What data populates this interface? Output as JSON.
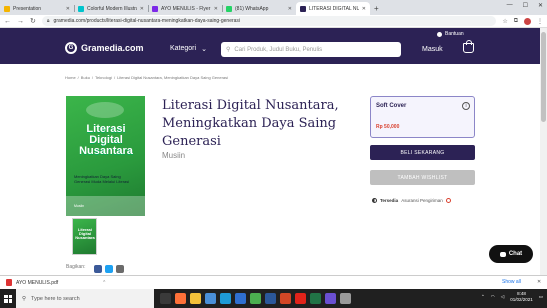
{
  "browser": {
    "tabs": [
      {
        "title": "Presentation",
        "color": "#f4b400"
      },
      {
        "title": "Colorful Modern Illustrated Lin...",
        "color": "#00c4cc"
      },
      {
        "title": "AYO MENULIS - Flyer (A4)",
        "color": "#7d2ae8"
      },
      {
        "title": "(81) WhatsApp",
        "color": "#25d366"
      },
      {
        "title": "LITERASI DIGITAL NUSANTARA...",
        "color": "#2c2255"
      }
    ],
    "new_tab": "+",
    "url": "gramedia.com/products/literasi-digital-nusantara-meningkatkan-daya-saing-generasi"
  },
  "header": {
    "logo": "Gramedia.com",
    "logo_letter": "G",
    "kategori": "Kategori",
    "search_placeholder": "Cari Produk, Judul Buku, Penulis",
    "bantuan": "Bantuan",
    "masuk": "Masuk"
  },
  "breadcrumb": [
    "Home",
    "/",
    "Buku",
    "/",
    "Teknologi",
    "/",
    "Literasi Digital Nusantara, Meningkatkan Daya Saing Generasi"
  ],
  "cover": {
    "title": "Literasi Digital Nusantara",
    "subtitle": "Meningkatkan Daya Saing Generasi Muda Melalui Literasi",
    "author": "Musiin"
  },
  "product": {
    "title": "Literasi Digital Nusantara, Meningkatkan Daya Saing Generasi",
    "author": "Musiin",
    "share_label": "Bagikan:",
    "variant": "Soft Cover",
    "price": "Rp 50,000",
    "buy_label": "BELI SEKARANG",
    "wishlist_label": "TAMBAH WISHLIST",
    "availability_prefix": "Tersedia",
    "availability_suffix": "Asuransi Pengiriman"
  },
  "chat_label": "Chat",
  "downloads": {
    "file": "AYO MENULIS.pdf",
    "show_all": "Show all"
  },
  "taskbar": {
    "search_placeholder": "Type here to search",
    "time": "8:48",
    "date": "01/02/2021"
  },
  "colors": {
    "brand": "#2c2255",
    "price": "#d9412f",
    "cover_green": "#2a9a3d"
  }
}
